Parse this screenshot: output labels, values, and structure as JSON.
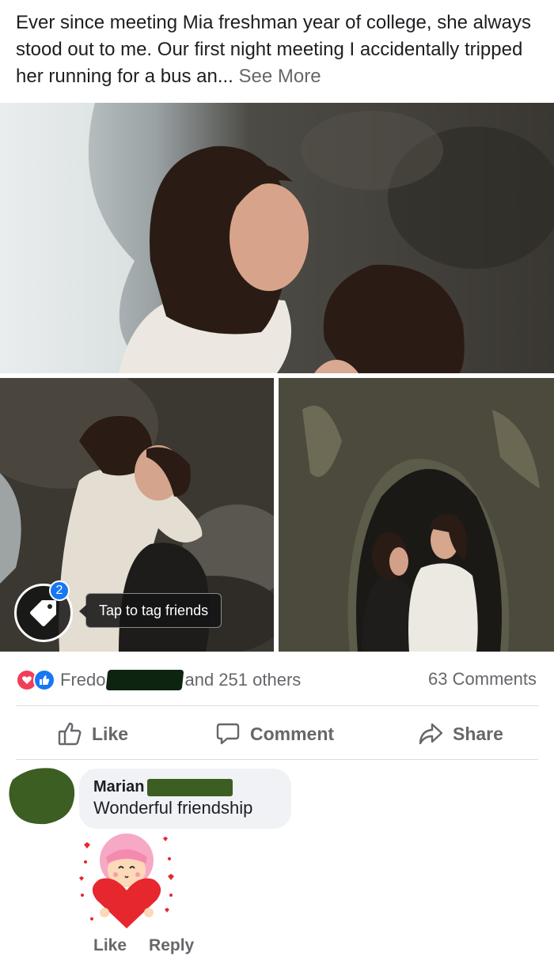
{
  "post": {
    "text": "Ever since meeting Mia freshman year of college, she always stood out to me. Our first night meeting I accidentally tripped her running for a bus an...",
    "see_more": "See More"
  },
  "photos": {
    "tag_count": "2",
    "tag_tip": "Tap to tag friends"
  },
  "reactions": {
    "name": "Fredo",
    "others": "and 251 others",
    "comments": "63 Comments"
  },
  "actions": {
    "like": "Like",
    "comment": "Comment",
    "share": "Share"
  },
  "comment": {
    "author": "Marian",
    "text": "Wonderful friendship",
    "like": "Like",
    "reply": "Reply"
  }
}
